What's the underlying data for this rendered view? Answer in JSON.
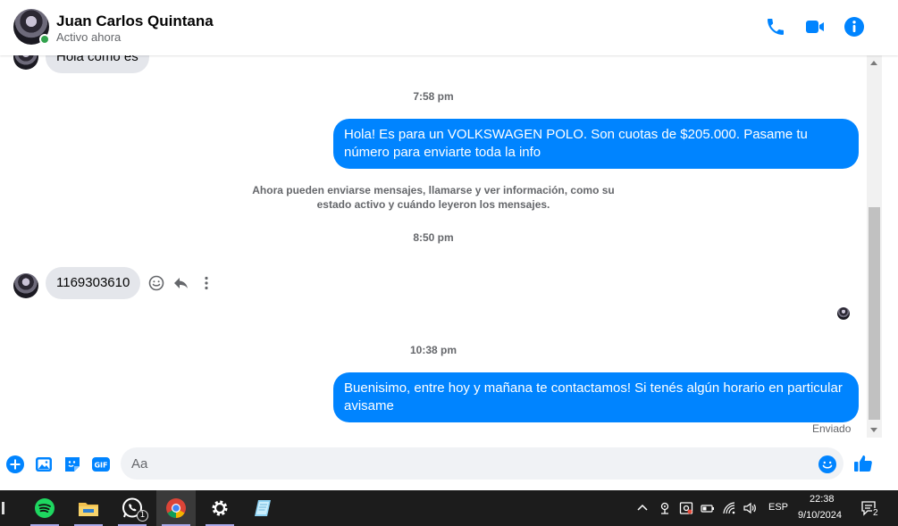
{
  "header": {
    "contact_name": "Juan Carlos Quintana",
    "status": "Activo ahora"
  },
  "messages": {
    "partial_incoming": "Hola como es",
    "time1": "7:58 pm",
    "outgoing1": "Hola! Es para un VOLKSWAGEN POLO. Son cuotas de $205.000. Pasame tu número para enviarte toda la info",
    "system_note": "Ahora pueden enviarse mensajes, llamarse y ver información, como su estado activo y cuándo leyeron los mensajes.",
    "time2": "8:50 pm",
    "incoming1": "1169303610",
    "time3": "10:38 pm",
    "outgoing2": "Buenisimo, entre hoy y mañana te contactamos! Si tenés algún horario en particular avisame",
    "delivery_status": "Enviado"
  },
  "composer": {
    "placeholder": "Aa"
  },
  "taskbar": {
    "apps": [
      "spotify-icon",
      "file-explorer-icon",
      "whatsapp-icon",
      "chrome-icon",
      "settings-icon",
      "notes-icon"
    ],
    "whatsapp_badge": "1",
    "language": "ESP",
    "time": "22:38",
    "date": "9/10/2024",
    "notification_count": "2"
  },
  "colors": {
    "accent": "#0084ff",
    "incoming_bubble": "#e4e6eb",
    "online": "#31a24c",
    "taskbar": "#1c1c1c"
  }
}
